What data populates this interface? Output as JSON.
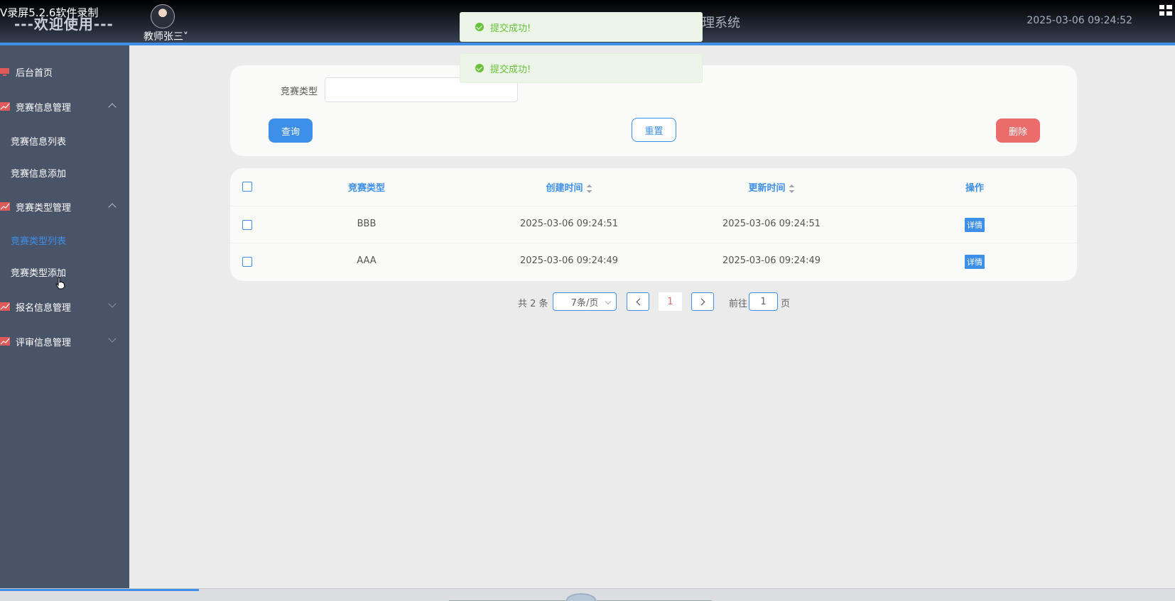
{
  "header": {
    "recorder_label": "V录屏5.2.6软件录制",
    "welcome": "---欢迎使用---",
    "user_name": "教师张三˅",
    "system_title_visible": "理系统",
    "datetime": "2025-03-06 09:24:52",
    "colors": {
      "accent": "#3d8fe8",
      "background_dark": "#1f2530"
    }
  },
  "sidebar": {
    "background": "#4a5468",
    "items": [
      {
        "label": "后台首页",
        "icon": "monitor-icon"
      },
      {
        "label": "竞赛信息管理",
        "icon": "chart-icon",
        "expanded": true
      },
      {
        "label": "竞赛信息列表"
      },
      {
        "label": "竞赛信息添加"
      },
      {
        "label": "竞赛类型管理",
        "icon": "chart-icon",
        "expanded": true
      },
      {
        "label": "竞赛类型列表",
        "active": true
      },
      {
        "label": "竞赛类型添加"
      },
      {
        "label": "报名信息管理",
        "icon": "chart-icon",
        "expanded": false
      },
      {
        "label": "评审信息管理",
        "icon": "chart-icon",
        "expanded": false
      }
    ]
  },
  "search": {
    "field_label": "竞赛类型",
    "field_value": "",
    "query_label": "查询",
    "reset_label": "重置",
    "delete_label": "删除"
  },
  "table": {
    "columns": [
      "竞赛类型",
      "创建时间",
      "更新时间",
      "操作"
    ],
    "rows": [
      {
        "type": "BBB",
        "created": "2025-03-06 09:24:51",
        "updated": "2025-03-06 09:24:51",
        "action": "详情"
      },
      {
        "type": "AAA",
        "created": "2025-03-06 09:24:49",
        "updated": "2025-03-06 09:24:49",
        "action": "详情"
      }
    ]
  },
  "pagination": {
    "total_text": "共 2 条",
    "page_size": "7条/页",
    "current_page": "1",
    "goto_prefix": "前往",
    "goto_value": "1",
    "goto_suffix": "页"
  },
  "toasts": [
    {
      "message": "提交成功!",
      "color": "#67c23a"
    },
    {
      "message": "提交成功!",
      "color": "#67c23a"
    }
  ]
}
